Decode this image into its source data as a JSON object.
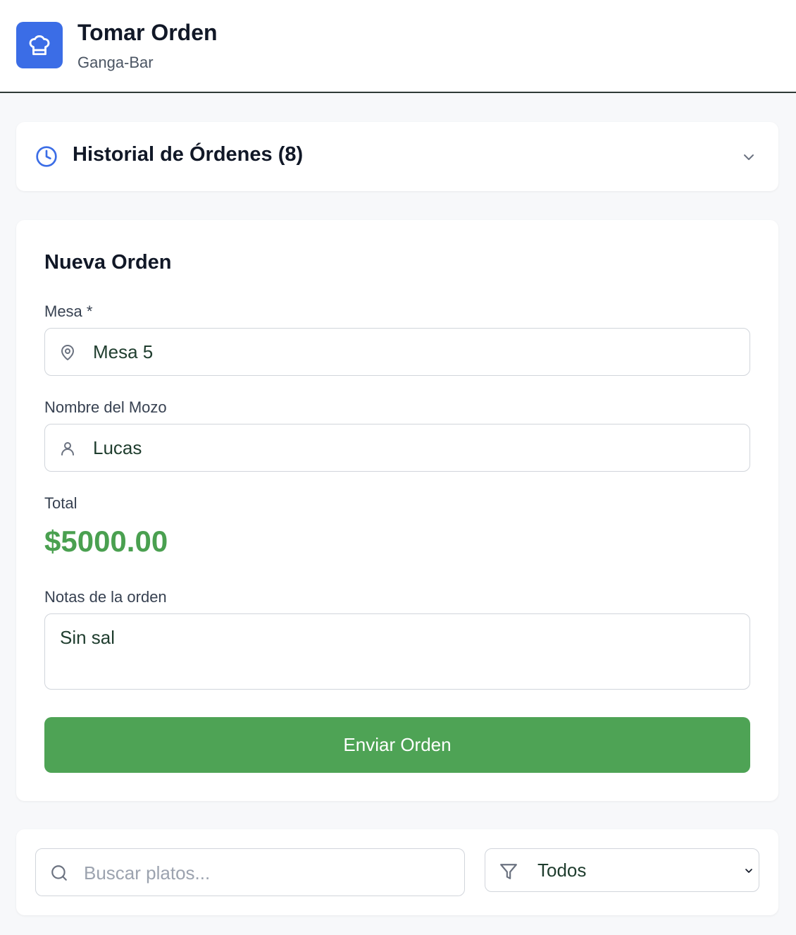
{
  "header": {
    "title": "Tomar Orden",
    "subtitle": "Ganga-Bar",
    "logo_icon": "chef-hat-icon",
    "logo_color": "#3b6de6"
  },
  "history": {
    "title": "Historial de Órdenes (8)",
    "icon": "clock-icon",
    "expanded": false
  },
  "order": {
    "title": "Nueva Orden",
    "table_label": "Mesa *",
    "table_value": "Mesa 5",
    "waiter_label": "Nombre del Mozo",
    "waiter_value": "Lucas",
    "total_label": "Total",
    "total_value": "$5000.00",
    "notes_label": "Notas de la orden",
    "notes_value": "Sin sal",
    "submit_label": "Enviar Orden",
    "accent_color": "#4ea355"
  },
  "filters": {
    "search_placeholder": "Buscar platos...",
    "category_value": "Todos"
  }
}
